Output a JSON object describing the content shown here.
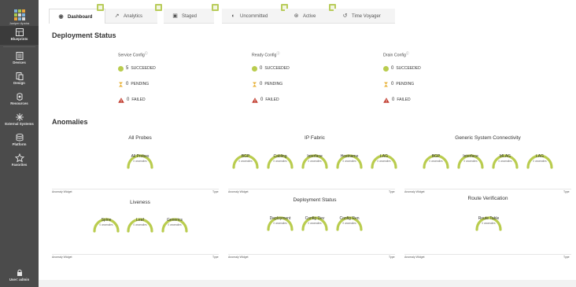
{
  "sidebar": {
    "logo_text": "Juniper Apstra",
    "items": [
      {
        "label": "Blueprints",
        "icon": "blueprint-icon"
      },
      {
        "label": "Devices",
        "icon": "devices-icon"
      },
      {
        "label": "Design",
        "icon": "design-icon"
      },
      {
        "label": "Resources",
        "icon": "resources-icon"
      },
      {
        "label": "External Systems",
        "icon": "external-systems-icon"
      },
      {
        "label": "Platform",
        "icon": "platform-icon"
      },
      {
        "label": "Favorites",
        "icon": "star-icon"
      }
    ],
    "user_label": "User: admin"
  },
  "tabs": [
    {
      "label": "Dashboard",
      "icon": "dashboard-icon"
    },
    {
      "label": "Analytics",
      "icon": "analytics-icon"
    },
    {
      "label": "Staged",
      "icon": "staged-icon"
    },
    {
      "label": "Uncommitted",
      "icon": "uncommitted-icon"
    },
    {
      "label": "Active",
      "icon": "active-icon"
    },
    {
      "label": "Time Voyager",
      "icon": "time-voyager-icon"
    }
  ],
  "deployment": {
    "title": "Deployment Status",
    "columns": [
      {
        "title": "Service Config",
        "succeeded": "5",
        "pending": "0",
        "failed": "0"
      },
      {
        "title": "Ready Config",
        "succeeded": "0",
        "pending": "0",
        "failed": "0"
      },
      {
        "title": "Drain Config",
        "succeeded": "0",
        "pending": "0",
        "failed": "0"
      }
    ],
    "labels": {
      "succeeded": "SUCCEEDED",
      "pending": "PENDING",
      "failed": "FAILED"
    }
  },
  "anomalies": {
    "title": "Anomalies",
    "anomaly_text": "0 anomalies",
    "groups": {
      "all_probes": {
        "title": "All Probes",
        "gauges": [
          "All Probes"
        ]
      },
      "ip_fabric": {
        "title": "IP Fabric",
        "gauges": [
          "BGP",
          "Cabling",
          "Interface",
          "Hostname",
          "LAG"
        ]
      },
      "generic": {
        "title": "Generic System Connectivity",
        "gauges": [
          "BGP",
          "Interface",
          "MLAG",
          "LAG"
        ]
      },
      "liveness": {
        "title": "Liveness",
        "gauges": [
          "Spine",
          "Leaf",
          "Generics"
        ]
      },
      "deployment_status": {
        "title": "Deployment Status",
        "gauges": [
          "Deployment",
          "Config Dev",
          "Config Ren"
        ]
      },
      "route_verification": {
        "title": "Route Verification",
        "gauges": [
          "Route Table"
        ]
      }
    },
    "panel_caption": "Anomaly Widget",
    "panel_caption_right": "Type"
  },
  "colors": {
    "accent": "#b9cc4e",
    "failed": "#c0392b",
    "pending": "#e8b33c",
    "sidebar": "#4b4b4b"
  }
}
